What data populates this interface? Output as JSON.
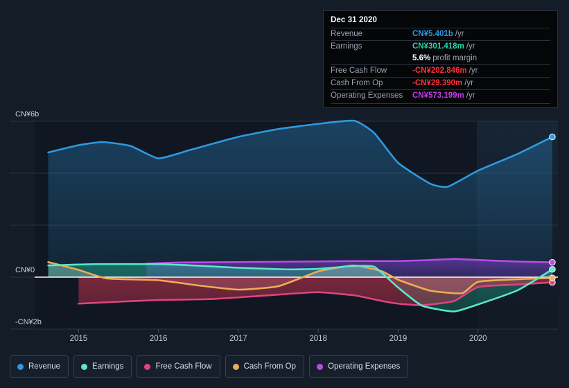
{
  "tooltip": {
    "title": "Dec 31 2020",
    "rows": [
      {
        "label": "Revenue",
        "value": "CN¥5.401b",
        "unit": "/yr",
        "color": "#2e9ae0"
      },
      {
        "label": "Earnings",
        "value": "CN¥301.418m",
        "unit": "/yr",
        "color": "#24d7ab"
      },
      {
        "label": "",
        "value": "5.6%",
        "unit": "profit margin",
        "color": "#ffffff"
      },
      {
        "label": "Free Cash Flow",
        "value": "-CN¥202.846m",
        "unit": "/yr",
        "color": "#ff2f3c"
      },
      {
        "label": "Cash From Op",
        "value": "-CN¥29.390m",
        "unit": "/yr",
        "color": "#ff2f3c"
      },
      {
        "label": "Operating Expenses",
        "value": "CN¥573.199m",
        "unit": "/yr",
        "color": "#c438ee"
      }
    ]
  },
  "legend": [
    {
      "label": "Revenue",
      "color": "#2e9ae0"
    },
    {
      "label": "Earnings",
      "color": "#5ae8c8"
    },
    {
      "label": "Free Cash Flow",
      "color": "#e0437f"
    },
    {
      "label": "Cash From Op",
      "color": "#eeac54"
    },
    {
      "label": "Operating Expenses",
      "color": "#bb4ae8"
    }
  ],
  "chart_data": {
    "type": "area",
    "title": "",
    "xlabel": "",
    "ylabel": "",
    "currency": "CN¥",
    "grid": true,
    "legend_position": "bottom",
    "ylim": [
      -2.4,
      6.6
    ],
    "yticks": [
      6,
      4,
      2,
      0,
      -2
    ],
    "ytick_labels": [
      "CN¥6b",
      "",
      "",
      "CN¥0",
      "-CN¥2b"
    ],
    "xlim": [
      2014.45,
      2021.0
    ],
    "xticks": [
      2015,
      2016,
      2017,
      2018,
      2019,
      2020
    ],
    "xtick_labels": [
      "2015",
      "2016",
      "2017",
      "2018",
      "2019",
      "2020"
    ],
    "units": "CN¥ billions",
    "series": [
      {
        "name": "Revenue",
        "color": "#2e9ae0",
        "x": [
          2014.62,
          2015.0,
          2015.3,
          2015.65,
          2016.0,
          2016.4,
          2017.0,
          2017.5,
          2018.0,
          2018.45,
          2018.7,
          2019.0,
          2019.4,
          2019.62,
          2020.0,
          2020.5,
          2020.93
        ],
        "y": [
          4.8,
          5.08,
          5.2,
          5.05,
          4.57,
          4.9,
          5.4,
          5.7,
          5.9,
          6.02,
          5.55,
          4.4,
          3.6,
          3.48,
          4.1,
          4.75,
          5.4
        ]
      },
      {
        "name": "Earnings",
        "color": "#5ae8c8",
        "x": [
          2014.62,
          2015.2,
          2016.0,
          2016.5,
          2017.0,
          2017.6,
          2018.0,
          2018.4,
          2018.7,
          2019.0,
          2019.3,
          2019.7,
          2020.0,
          2020.5,
          2020.93
        ],
        "y": [
          0.45,
          0.5,
          0.5,
          0.44,
          0.36,
          0.3,
          0.32,
          0.42,
          0.4,
          -0.4,
          -1.1,
          -1.32,
          -1.05,
          -0.5,
          0.3
        ]
      },
      {
        "name": "Free Cash Flow",
        "color": "#e0437f",
        "x": [
          2015.0,
          2015.4,
          2016.0,
          2016.6,
          2017.0,
          2017.6,
          2018.0,
          2018.45,
          2018.8,
          2019.0,
          2019.3,
          2019.7,
          2020.0,
          2020.5,
          2020.93
        ],
        "y": [
          -1.02,
          -0.96,
          -0.88,
          -0.85,
          -0.78,
          -0.65,
          -0.58,
          -0.7,
          -0.92,
          -1.02,
          -1.08,
          -0.92,
          -0.38,
          -0.28,
          -0.2
        ]
      },
      {
        "name": "Cash From Op",
        "color": "#eeac54",
        "x": [
          2014.62,
          2015.0,
          2015.35,
          2016.0,
          2016.5,
          2017.0,
          2017.5,
          2018.0,
          2018.45,
          2018.8,
          2019.0,
          2019.4,
          2019.8,
          2020.0,
          2020.5,
          2020.93
        ],
        "y": [
          0.58,
          0.28,
          -0.05,
          -0.12,
          -0.32,
          -0.48,
          -0.35,
          0.22,
          0.45,
          0.22,
          -0.1,
          -0.52,
          -0.62,
          -0.18,
          -0.08,
          -0.03
        ]
      },
      {
        "name": "Operating Expenses",
        "color": "#bb4ae8",
        "x": [
          2015.85,
          2016.2,
          2017.0,
          2017.8,
          2018.5,
          2019.0,
          2019.4,
          2019.7,
          2020.0,
          2020.5,
          2020.93
        ],
        "y": [
          0.52,
          0.56,
          0.58,
          0.6,
          0.62,
          0.62,
          0.66,
          0.7,
          0.66,
          0.6,
          0.57
        ]
      }
    ]
  }
}
